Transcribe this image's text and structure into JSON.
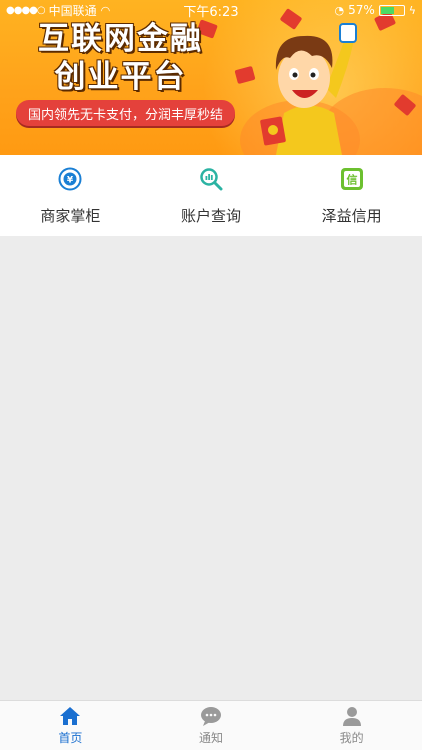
{
  "status_bar": {
    "carrier": "中国联通",
    "time": "下午6:23",
    "battery_percent": "57%"
  },
  "banner": {
    "headline_line1": "互联网金融",
    "headline_line2": "创业平台",
    "tagline": "国内领先无卡支付，分润丰厚秒结"
  },
  "quick_menu": [
    {
      "label": "商家掌柜",
      "icon": "merchant-icon",
      "color": "#1a7fd4"
    },
    {
      "label": "账户查询",
      "icon": "account-search-icon",
      "color": "#2bb3a3"
    },
    {
      "label": "泽益信用",
      "icon": "credit-icon",
      "color": "#6cc02f"
    }
  ],
  "tab_bar": [
    {
      "label": "首页",
      "icon": "home-icon",
      "active": true
    },
    {
      "label": "通知",
      "icon": "chat-icon",
      "active": false
    },
    {
      "label": "我的",
      "icon": "profile-icon",
      "active": false
    }
  ],
  "colors": {
    "active_tab": "#1a6fd0",
    "inactive_tab": "#8a8a8a",
    "banner": "#ffa21a"
  }
}
